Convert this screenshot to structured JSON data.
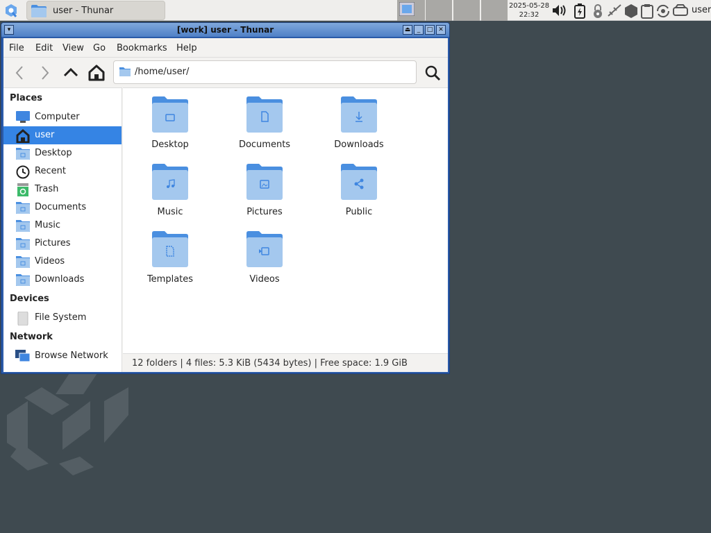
{
  "panel": {
    "task_title": "user - Thunar",
    "date": "2025-05-28",
    "time": "22:32",
    "user": "user"
  },
  "window": {
    "title": "[work] user - Thunar"
  },
  "menu": [
    "File",
    "Edit",
    "View",
    "Go",
    "Bookmarks",
    "Help"
  ],
  "location": {
    "path": "/home/user/"
  },
  "sidebar": {
    "places_header": "Places",
    "places": [
      {
        "label": "Computer",
        "icon": "computer-icon"
      },
      {
        "label": "user",
        "icon": "home-icon",
        "selected": true
      },
      {
        "label": "Desktop",
        "icon": "folder-icon"
      },
      {
        "label": "Recent",
        "icon": "clock-icon"
      },
      {
        "label": "Trash",
        "icon": "trash-icon"
      },
      {
        "label": "Documents",
        "icon": "folder-icon"
      },
      {
        "label": "Music",
        "icon": "folder-icon"
      },
      {
        "label": "Pictures",
        "icon": "folder-icon"
      },
      {
        "label": "Videos",
        "icon": "folder-icon"
      },
      {
        "label": "Downloads",
        "icon": "folder-icon"
      }
    ],
    "devices_header": "Devices",
    "devices": [
      {
        "label": "File System",
        "icon": "drive-icon"
      }
    ],
    "network_header": "Network",
    "network": [
      {
        "label": "Browse Network",
        "icon": "network-icon"
      }
    ]
  },
  "folders": [
    {
      "label": "Desktop"
    },
    {
      "label": "Documents"
    },
    {
      "label": "Downloads"
    },
    {
      "label": "Music"
    },
    {
      "label": "Pictures"
    },
    {
      "label": "Public"
    },
    {
      "label": "Templates"
    },
    {
      "label": "Videos"
    }
  ],
  "status": "12 folders  |  4 files: 5.3 KiB (5434 bytes)  |  Free space: 1.9 GiB",
  "colors": {
    "accent": "#3584e4",
    "folder_back": "#4a8fe0",
    "folder_front": "#a4c8ee"
  }
}
